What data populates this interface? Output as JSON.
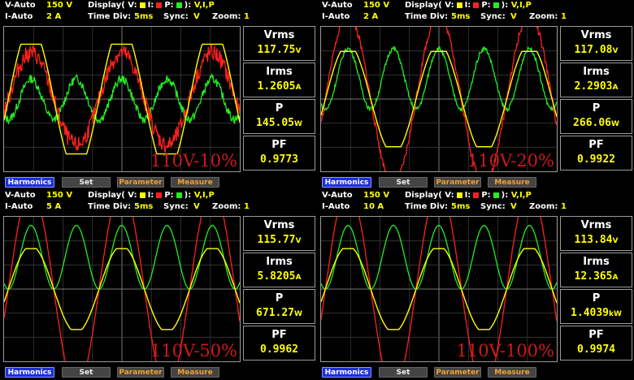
{
  "colors": {
    "voltage": "#ffff00",
    "current": "#ff2020",
    "power": "#22ee22",
    "accent": "#ffff00",
    "tag": "#cc1a1a"
  },
  "common": {
    "v_auto_label": "V-Auto",
    "i_auto_label": "I-Auto",
    "display_prefix": "Display(",
    "v_key": "V:",
    "i_key": "I:",
    "p_key": "P:",
    "display_suffix": "):",
    "display_value": "V,I,P",
    "time_div_label": "Time  Div:",
    "time_div_value": "5ms",
    "sync_label": "Sync:",
    "sync_value": "V",
    "zoom_label": "Zoom:",
    "zoom_value": "1",
    "buttons": {
      "harmonics": "Harmonics",
      "set": "Set",
      "parameter": "Parameter",
      "measure": "Measure"
    },
    "meas_labels": {
      "vrms": "Vrms",
      "irms": "Irms",
      "p": "P",
      "pf": "PF"
    }
  },
  "panels": [
    {
      "v_range": "150  V",
      "i_range": "2  A",
      "vrms": "117.75",
      "vrms_unit": "V",
      "irms": "1.2605",
      "irms_unit": "A",
      "p": "145.05",
      "p_unit": "W",
      "pf": "0.9773",
      "tag": "110V-10%",
      "waveform": {
        "cycles": 2.6,
        "v_amp": 0.5,
        "v_clip": 0.38,
        "i_amp": 0.32,
        "i_noise": 0.12,
        "p_amp": 0.28,
        "p_offset": 0.0,
        "p_noise": 0.06
      }
    },
    {
      "v_range": "150  V",
      "i_range": "2  A",
      "vrms": "117.08",
      "vrms_unit": "V",
      "irms": "2.2903",
      "irms_unit": "A",
      "p": "266.06",
      "p_unit": "W",
      "pf": "0.9922",
      "tag": "110V-20%",
      "waveform": {
        "cycles": 2.6,
        "v_amp": 0.38,
        "v_clip": 0.33,
        "i_amp": 0.58,
        "i_noise": 0.05,
        "p_amp": 0.42,
        "p_offset": 0.14,
        "p_noise": 0.03
      }
    },
    {
      "v_range": "150  V",
      "i_range": "5  A",
      "vrms": "115.77",
      "vrms_unit": "V",
      "irms": "5.8205",
      "irms_unit": "A",
      "p": "671.27",
      "p_unit": "W",
      "pf": "0.9962",
      "tag": "110V-50%",
      "waveform": {
        "cycles": 2.6,
        "v_amp": 0.3,
        "v_clip": 0.28,
        "i_amp": 0.7,
        "i_noise": 0.01,
        "p_amp": 0.44,
        "p_offset": 0.22,
        "p_noise": 0.0
      }
    },
    {
      "v_range": "150  V",
      "i_range": "10  A",
      "vrms": "113.84",
      "vrms_unit": "V",
      "irms": "12.365",
      "irms_unit": "A",
      "p": "1.4039",
      "p_unit": "kW",
      "pf": "0.9974",
      "tag": "110V-100%",
      "waveform": {
        "cycles": 2.6,
        "v_amp": 0.3,
        "v_clip": 0.28,
        "i_amp": 0.7,
        "i_noise": 0.01,
        "p_amp": 0.44,
        "p_offset": 0.22,
        "p_noise": 0.0
      }
    }
  ]
}
